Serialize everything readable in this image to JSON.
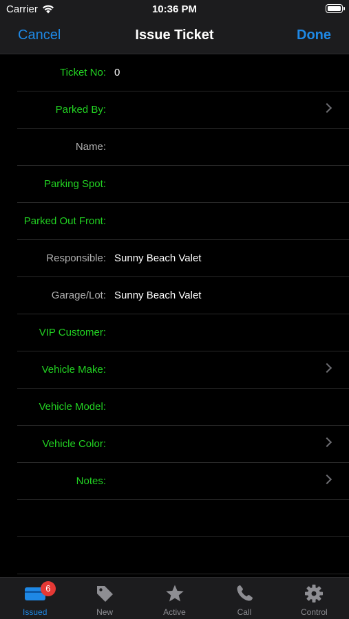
{
  "status_bar": {
    "carrier": "Carrier",
    "time": "10:36 PM"
  },
  "nav": {
    "cancel_label": "Cancel",
    "title": "Issue Ticket",
    "done_label": "Done"
  },
  "form": {
    "rows": [
      {
        "label": "Ticket No:",
        "value": "0",
        "label_color": "green",
        "chevron": false
      },
      {
        "label": "Parked By:",
        "value": "",
        "label_color": "green",
        "chevron": true
      },
      {
        "label": "Name:",
        "value": "",
        "label_color": "gray",
        "chevron": false
      },
      {
        "label": "Parking Spot:",
        "value": "",
        "label_color": "green",
        "chevron": false
      },
      {
        "label": "Parked Out Front:",
        "value": "",
        "label_color": "green",
        "chevron": false
      },
      {
        "label": "Responsible:",
        "value": "Sunny Beach Valet",
        "label_color": "gray",
        "chevron": false
      },
      {
        "label": "Garage/Lot:",
        "value": "Sunny Beach Valet",
        "label_color": "gray",
        "chevron": false
      },
      {
        "label": "VIP Customer:",
        "value": "",
        "label_color": "green",
        "chevron": false
      },
      {
        "label": "Vehicle Make:",
        "value": "",
        "label_color": "green",
        "chevron": true
      },
      {
        "label": "Vehicle Model:",
        "value": "",
        "label_color": "green",
        "chevron": false
      },
      {
        "label": "Vehicle Color:",
        "value": "",
        "label_color": "green",
        "chevron": true
      },
      {
        "label": "Notes:",
        "value": "",
        "label_color": "green",
        "chevron": true
      }
    ]
  },
  "tab_bar": {
    "tabs": [
      {
        "label": "Issued",
        "icon": "ticket-icon",
        "badge": "6",
        "active": true
      },
      {
        "label": "New",
        "icon": "tag-icon",
        "active": false
      },
      {
        "label": "Active",
        "icon": "star-icon",
        "active": false
      },
      {
        "label": "Call",
        "icon": "phone-icon",
        "active": false
      },
      {
        "label": "Control",
        "icon": "gear-icon",
        "active": false
      }
    ]
  },
  "colors": {
    "accent": "#1e88e5",
    "required_label": "#22d322",
    "optional_label": "#b0b0b0",
    "badge": "#e53935"
  }
}
